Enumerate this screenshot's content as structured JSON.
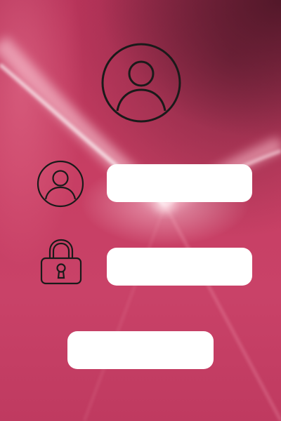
{
  "login": {
    "username_field": {
      "value": "",
      "placeholder": ""
    },
    "password_field": {
      "value": "",
      "placeholder": ""
    },
    "submit_label": ""
  },
  "icons": {
    "profile": "profile-avatar-icon",
    "user": "user-icon",
    "password": "lock-icon"
  },
  "colors": {
    "background": "#c23d5f",
    "field": "#ffffff",
    "icon_stroke": "#1a1a1a"
  }
}
